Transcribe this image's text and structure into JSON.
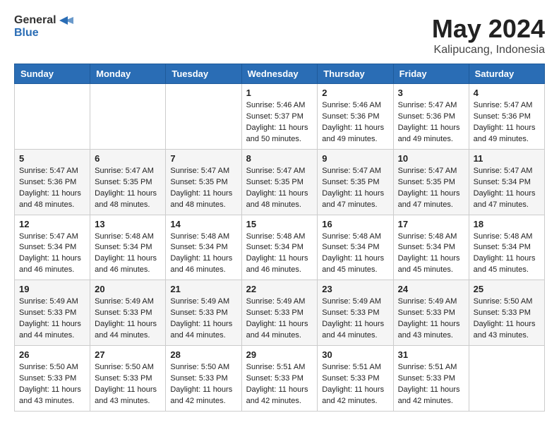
{
  "logo": {
    "general": "General",
    "blue": "Blue"
  },
  "header": {
    "month": "May 2024",
    "location": "Kalipucang, Indonesia"
  },
  "weekdays": [
    "Sunday",
    "Monday",
    "Tuesday",
    "Wednesday",
    "Thursday",
    "Friday",
    "Saturday"
  ],
  "weeks": [
    [
      {
        "day": "",
        "sunrise": "",
        "sunset": "",
        "daylight": ""
      },
      {
        "day": "",
        "sunrise": "",
        "sunset": "",
        "daylight": ""
      },
      {
        "day": "",
        "sunrise": "",
        "sunset": "",
        "daylight": ""
      },
      {
        "day": "1",
        "sunrise": "Sunrise: 5:46 AM",
        "sunset": "Sunset: 5:37 PM",
        "daylight": "Daylight: 11 hours and 50 minutes."
      },
      {
        "day": "2",
        "sunrise": "Sunrise: 5:46 AM",
        "sunset": "Sunset: 5:36 PM",
        "daylight": "Daylight: 11 hours and 49 minutes."
      },
      {
        "day": "3",
        "sunrise": "Sunrise: 5:47 AM",
        "sunset": "Sunset: 5:36 PM",
        "daylight": "Daylight: 11 hours and 49 minutes."
      },
      {
        "day": "4",
        "sunrise": "Sunrise: 5:47 AM",
        "sunset": "Sunset: 5:36 PM",
        "daylight": "Daylight: 11 hours and 49 minutes."
      }
    ],
    [
      {
        "day": "5",
        "sunrise": "Sunrise: 5:47 AM",
        "sunset": "Sunset: 5:36 PM",
        "daylight": "Daylight: 11 hours and 48 minutes."
      },
      {
        "day": "6",
        "sunrise": "Sunrise: 5:47 AM",
        "sunset": "Sunset: 5:35 PM",
        "daylight": "Daylight: 11 hours and 48 minutes."
      },
      {
        "day": "7",
        "sunrise": "Sunrise: 5:47 AM",
        "sunset": "Sunset: 5:35 PM",
        "daylight": "Daylight: 11 hours and 48 minutes."
      },
      {
        "day": "8",
        "sunrise": "Sunrise: 5:47 AM",
        "sunset": "Sunset: 5:35 PM",
        "daylight": "Daylight: 11 hours and 48 minutes."
      },
      {
        "day": "9",
        "sunrise": "Sunrise: 5:47 AM",
        "sunset": "Sunset: 5:35 PM",
        "daylight": "Daylight: 11 hours and 47 minutes."
      },
      {
        "day": "10",
        "sunrise": "Sunrise: 5:47 AM",
        "sunset": "Sunset: 5:35 PM",
        "daylight": "Daylight: 11 hours and 47 minutes."
      },
      {
        "day": "11",
        "sunrise": "Sunrise: 5:47 AM",
        "sunset": "Sunset: 5:34 PM",
        "daylight": "Daylight: 11 hours and 47 minutes."
      }
    ],
    [
      {
        "day": "12",
        "sunrise": "Sunrise: 5:47 AM",
        "sunset": "Sunset: 5:34 PM",
        "daylight": "Daylight: 11 hours and 46 minutes."
      },
      {
        "day": "13",
        "sunrise": "Sunrise: 5:48 AM",
        "sunset": "Sunset: 5:34 PM",
        "daylight": "Daylight: 11 hours and 46 minutes."
      },
      {
        "day": "14",
        "sunrise": "Sunrise: 5:48 AM",
        "sunset": "Sunset: 5:34 PM",
        "daylight": "Daylight: 11 hours and 46 minutes."
      },
      {
        "day": "15",
        "sunrise": "Sunrise: 5:48 AM",
        "sunset": "Sunset: 5:34 PM",
        "daylight": "Daylight: 11 hours and 46 minutes."
      },
      {
        "day": "16",
        "sunrise": "Sunrise: 5:48 AM",
        "sunset": "Sunset: 5:34 PM",
        "daylight": "Daylight: 11 hours and 45 minutes."
      },
      {
        "day": "17",
        "sunrise": "Sunrise: 5:48 AM",
        "sunset": "Sunset: 5:34 PM",
        "daylight": "Daylight: 11 hours and 45 minutes."
      },
      {
        "day": "18",
        "sunrise": "Sunrise: 5:48 AM",
        "sunset": "Sunset: 5:34 PM",
        "daylight": "Daylight: 11 hours and 45 minutes."
      }
    ],
    [
      {
        "day": "19",
        "sunrise": "Sunrise: 5:49 AM",
        "sunset": "Sunset: 5:33 PM",
        "daylight": "Daylight: 11 hours and 44 minutes."
      },
      {
        "day": "20",
        "sunrise": "Sunrise: 5:49 AM",
        "sunset": "Sunset: 5:33 PM",
        "daylight": "Daylight: 11 hours and 44 minutes."
      },
      {
        "day": "21",
        "sunrise": "Sunrise: 5:49 AM",
        "sunset": "Sunset: 5:33 PM",
        "daylight": "Daylight: 11 hours and 44 minutes."
      },
      {
        "day": "22",
        "sunrise": "Sunrise: 5:49 AM",
        "sunset": "Sunset: 5:33 PM",
        "daylight": "Daylight: 11 hours and 44 minutes."
      },
      {
        "day": "23",
        "sunrise": "Sunrise: 5:49 AM",
        "sunset": "Sunset: 5:33 PM",
        "daylight": "Daylight: 11 hours and 44 minutes."
      },
      {
        "day": "24",
        "sunrise": "Sunrise: 5:49 AM",
        "sunset": "Sunset: 5:33 PM",
        "daylight": "Daylight: 11 hours and 43 minutes."
      },
      {
        "day": "25",
        "sunrise": "Sunrise: 5:50 AM",
        "sunset": "Sunset: 5:33 PM",
        "daylight": "Daylight: 11 hours and 43 minutes."
      }
    ],
    [
      {
        "day": "26",
        "sunrise": "Sunrise: 5:50 AM",
        "sunset": "Sunset: 5:33 PM",
        "daylight": "Daylight: 11 hours and 43 minutes."
      },
      {
        "day": "27",
        "sunrise": "Sunrise: 5:50 AM",
        "sunset": "Sunset: 5:33 PM",
        "daylight": "Daylight: 11 hours and 43 minutes."
      },
      {
        "day": "28",
        "sunrise": "Sunrise: 5:50 AM",
        "sunset": "Sunset: 5:33 PM",
        "daylight": "Daylight: 11 hours and 42 minutes."
      },
      {
        "day": "29",
        "sunrise": "Sunrise: 5:51 AM",
        "sunset": "Sunset: 5:33 PM",
        "daylight": "Daylight: 11 hours and 42 minutes."
      },
      {
        "day": "30",
        "sunrise": "Sunrise: 5:51 AM",
        "sunset": "Sunset: 5:33 PM",
        "daylight": "Daylight: 11 hours and 42 minutes."
      },
      {
        "day": "31",
        "sunrise": "Sunrise: 5:51 AM",
        "sunset": "Sunset: 5:33 PM",
        "daylight": "Daylight: 11 hours and 42 minutes."
      },
      {
        "day": "",
        "sunrise": "",
        "sunset": "",
        "daylight": ""
      }
    ]
  ]
}
